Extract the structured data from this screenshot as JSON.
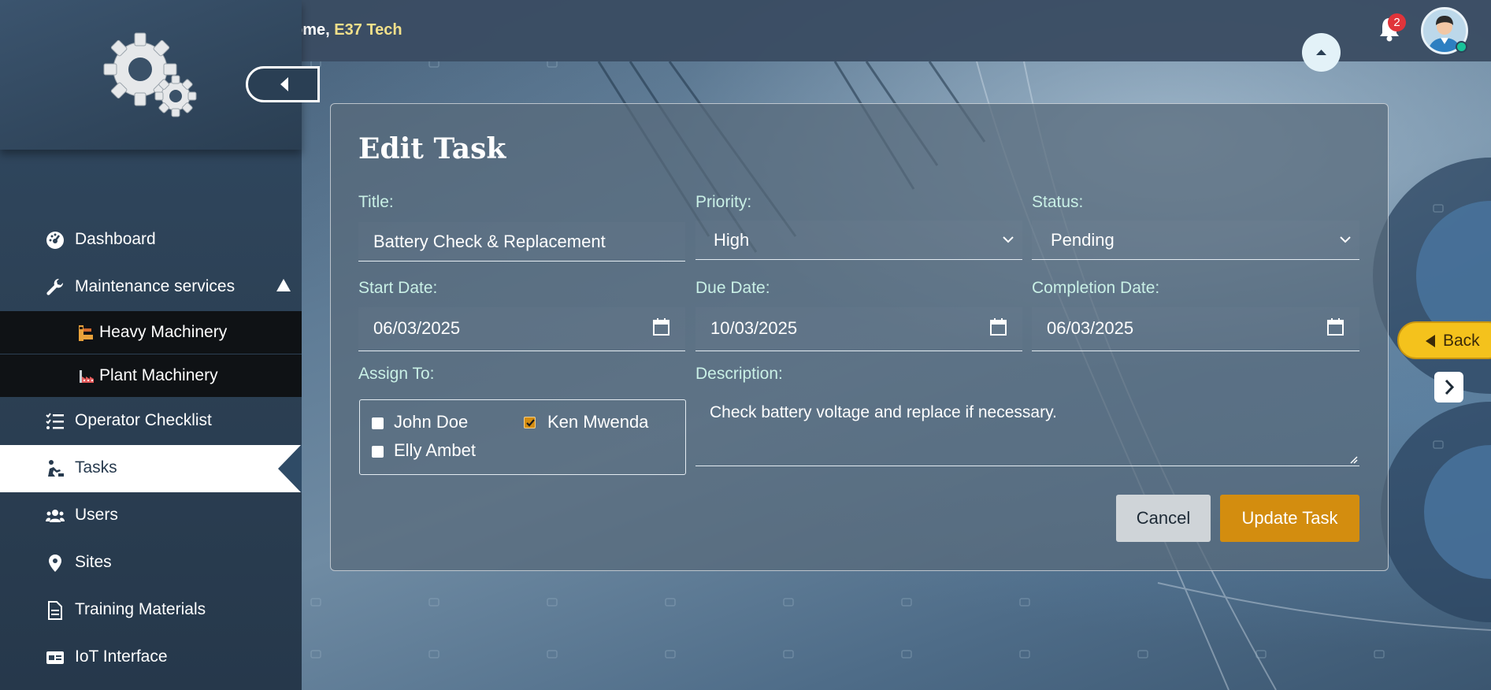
{
  "header": {
    "welcome_prefix": "ome,",
    "org_name": "E37 Tech",
    "notification_count": "2"
  },
  "sidebar": {
    "items": [
      {
        "label": "Dashboard",
        "icon": "dashboard-gauge-icon"
      },
      {
        "label": "Maintenance services",
        "icon": "wrench-icon",
        "expanded": true
      },
      {
        "label": "Heavy Machinery",
        "icon": "excavator-icon",
        "sub": true
      },
      {
        "label": "Plant Machinery",
        "icon": "factory-icon",
        "sub": true
      },
      {
        "label": "Operator Checklist",
        "icon": "checklist-icon"
      },
      {
        "label": "Tasks",
        "icon": "worker-tasks-icon",
        "active": true
      },
      {
        "label": "Users",
        "icon": "users-icon"
      },
      {
        "label": "Sites",
        "icon": "map-pin-icon"
      },
      {
        "label": "Training Materials",
        "icon": "document-icon"
      },
      {
        "label": "IoT Interface",
        "icon": "id-card-icon"
      }
    ]
  },
  "form": {
    "title": "Edit Task",
    "title_label": "Title:",
    "title_value": "Battery Check & Replacement",
    "priority_label": "Priority:",
    "priority_value": "High",
    "status_label": "Status:",
    "status_value": "Pending",
    "start_label": "Start Date:",
    "start_value": "06/03/2025",
    "due_label": "Due Date:",
    "due_value": "10/03/2025",
    "completion_label": "Completion Date:",
    "completion_value": "06/03/2025",
    "assign_label": "Assign To:",
    "assignees": [
      {
        "name": "John Doe",
        "checked": false
      },
      {
        "name": "Ken Mwenda",
        "checked": true
      },
      {
        "name": "Elly Ambet",
        "checked": false
      }
    ],
    "description_label": "Description:",
    "description_value": "Check battery voltage and replace if necessary.",
    "cancel_label": "Cancel",
    "update_label": "Update Task"
  },
  "side_controls": {
    "back_label": "Back"
  },
  "colors": {
    "accent": "#d38d0f",
    "label": "#c9f0e6",
    "back_button": "#f4c21c",
    "org_name": "#f2e08a"
  }
}
